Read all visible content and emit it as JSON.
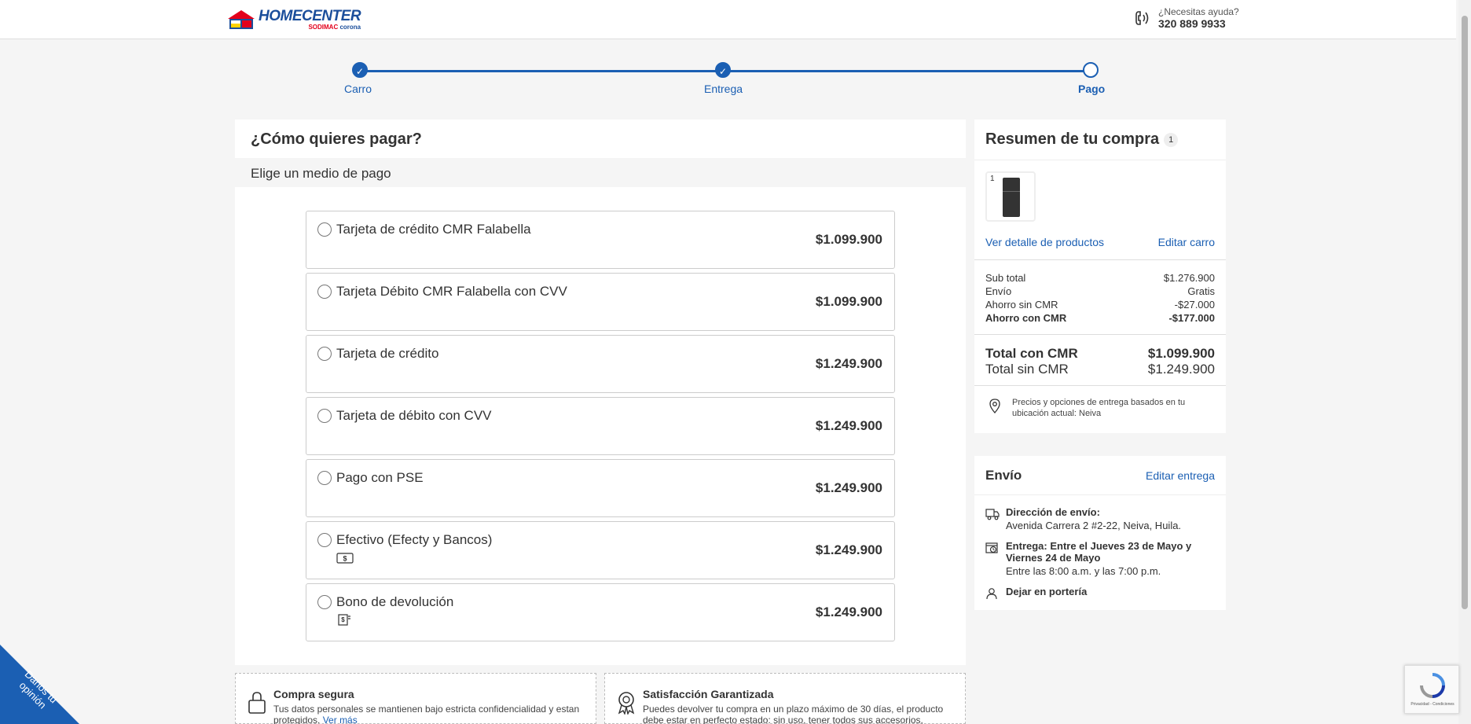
{
  "header": {
    "logo_main": "HOMECENTER",
    "logo_sub_a": "SODIMAC",
    "logo_sub_b": "corona",
    "help_question": "¿Necesitas ayuda?",
    "help_phone": "320 889 9933"
  },
  "stepper": {
    "steps": [
      {
        "label": "Carro",
        "state": "done"
      },
      {
        "label": "Entrega",
        "state": "done"
      },
      {
        "label": "Pago",
        "state": "current"
      }
    ],
    "check_glyph": "✓"
  },
  "payment": {
    "title": "¿Cómo quieres pagar?",
    "subtitle": "Elige un medio de pago",
    "options": [
      {
        "label": "Tarjeta de crédito CMR Falabella",
        "price": "$1.099.900"
      },
      {
        "label": "Tarjeta Débito CMR Falabella con CVV",
        "price": "$1.099.900"
      },
      {
        "label": "Tarjeta de crédito",
        "price": "$1.249.900"
      },
      {
        "label": "Tarjeta de débito con CVV",
        "price": "$1.249.900"
      },
      {
        "label": "Pago con PSE",
        "price": "$1.249.900"
      },
      {
        "label": "Efectivo (Efecty y Bancos)",
        "price": "$1.249.900",
        "icon": "cash-icon"
      },
      {
        "label": "Bono de devolución",
        "price": "$1.249.900",
        "icon": "voucher-icon"
      }
    ]
  },
  "trust": [
    {
      "title": "Compra segura",
      "text": "Tus datos personales se mantienen bajo estricta confidencialidad y estan protegidos.",
      "link": "Ver más",
      "icon": "lock-icon"
    },
    {
      "title": "Satisfacción Garantizada",
      "text": "Puedes devolver tu compra en un plazo máximo de 30 días, el producto debe estar en perfecto estado: sin uso, tener todos sus accesorios, manuales y",
      "icon": "award-icon"
    }
  ],
  "summary": {
    "title": "Resumen de tu compra",
    "count": "1",
    "thumb_qty": "1",
    "view_detail": "Ver detalle de productos",
    "edit_cart": "Editar carro",
    "rows": [
      {
        "label": "Sub total",
        "value": "$1.276.900",
        "bold": false
      },
      {
        "label": "Envío",
        "value": "Gratis",
        "bold": false
      },
      {
        "label": "Ahorro sin CMR",
        "value": "-$27.000",
        "bold": false
      },
      {
        "label": "Ahorro con CMR",
        "value": "-$177.000",
        "bold": true
      }
    ],
    "totals": [
      {
        "label": "Total con CMR",
        "value": "$1.099.900",
        "bold": true
      },
      {
        "label": "Total sin CMR",
        "value": "$1.249.900",
        "bold": false
      }
    ],
    "location_note": "Precios y opciones de entrega basados en tu ubicación actual: Neiva"
  },
  "envio": {
    "title": "Envío",
    "edit": "Editar entrega",
    "address_label": "Dirección de envío:",
    "address": "Avenida Carrera 2 #2-22, Neiva, Huila.",
    "delivery_label": "Entrega: Entre el Jueves 23 de Mayo y Viernes 24 de Mayo",
    "delivery_hours": "Entre las 8:00 a.m. y las 7:00 p.m.",
    "leave_at": "Dejar en portería"
  },
  "feedback": {
    "label": "Danos tu opinión"
  },
  "recaptcha": {
    "text": "Privacidad - Condiciones"
  },
  "colors": {
    "brand_blue": "#1b5fb3",
    "brand_red": "#e3001b",
    "logo_blue": "#1b4e9b"
  }
}
